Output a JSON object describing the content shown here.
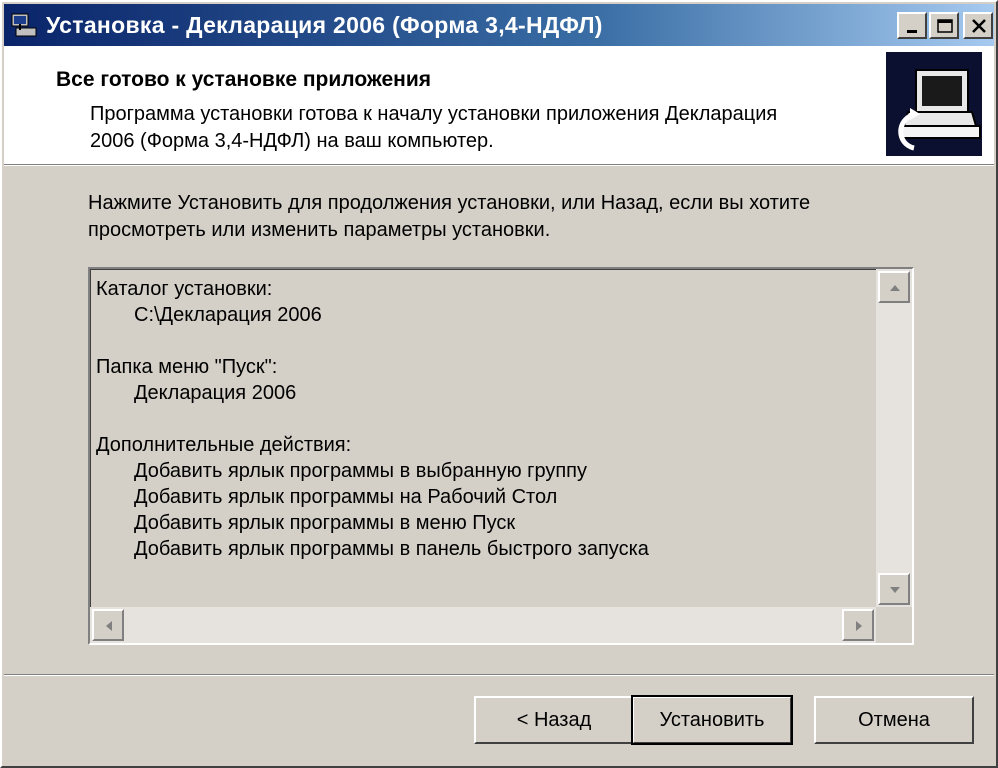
{
  "window": {
    "title": "Установка - Декларация 2006 (Форма 3,4-НДФЛ)",
    "icon": "installer-icon",
    "controls": [
      "minimize-icon",
      "maximize-icon",
      "close-icon"
    ]
  },
  "header": {
    "title": "Все готово к установке приложения",
    "subtitle_line1": "Программа установки готова к началу установки приложения Декларация",
    "subtitle_line2": "2006 (Форма 3,4-НДФЛ) на ваш компьютер.",
    "logo": "computer-install-icon"
  },
  "instructions": {
    "line1": "Нажмите Установить для продолжения установки, или Назад, если вы хотите",
    "line2": "просмотреть или изменить параметры установки."
  },
  "summary": {
    "install_dir_label": "Каталог установки:",
    "install_dir_value": "C:\\Декларация 2006",
    "start_menu_label": "Папка меню \"Пуск\":",
    "start_menu_value": "Декларация 2006",
    "tasks_label": "Дополнительные действия:",
    "tasks": [
      "Добавить ярлык программы в выбранную группу",
      "Добавить ярлык программы на Рабочий Стол",
      "Добавить ярлык программы в меню Пуск",
      "Добавить ярлык программы в панель быстрого запуска"
    ]
  },
  "buttons": {
    "back": "< Назад",
    "install": "Установить",
    "cancel": "Отмена"
  },
  "colors": {
    "titlebar_start": "#0a246a",
    "titlebar_end": "#a6caf0",
    "face": "#d4d0c8"
  }
}
